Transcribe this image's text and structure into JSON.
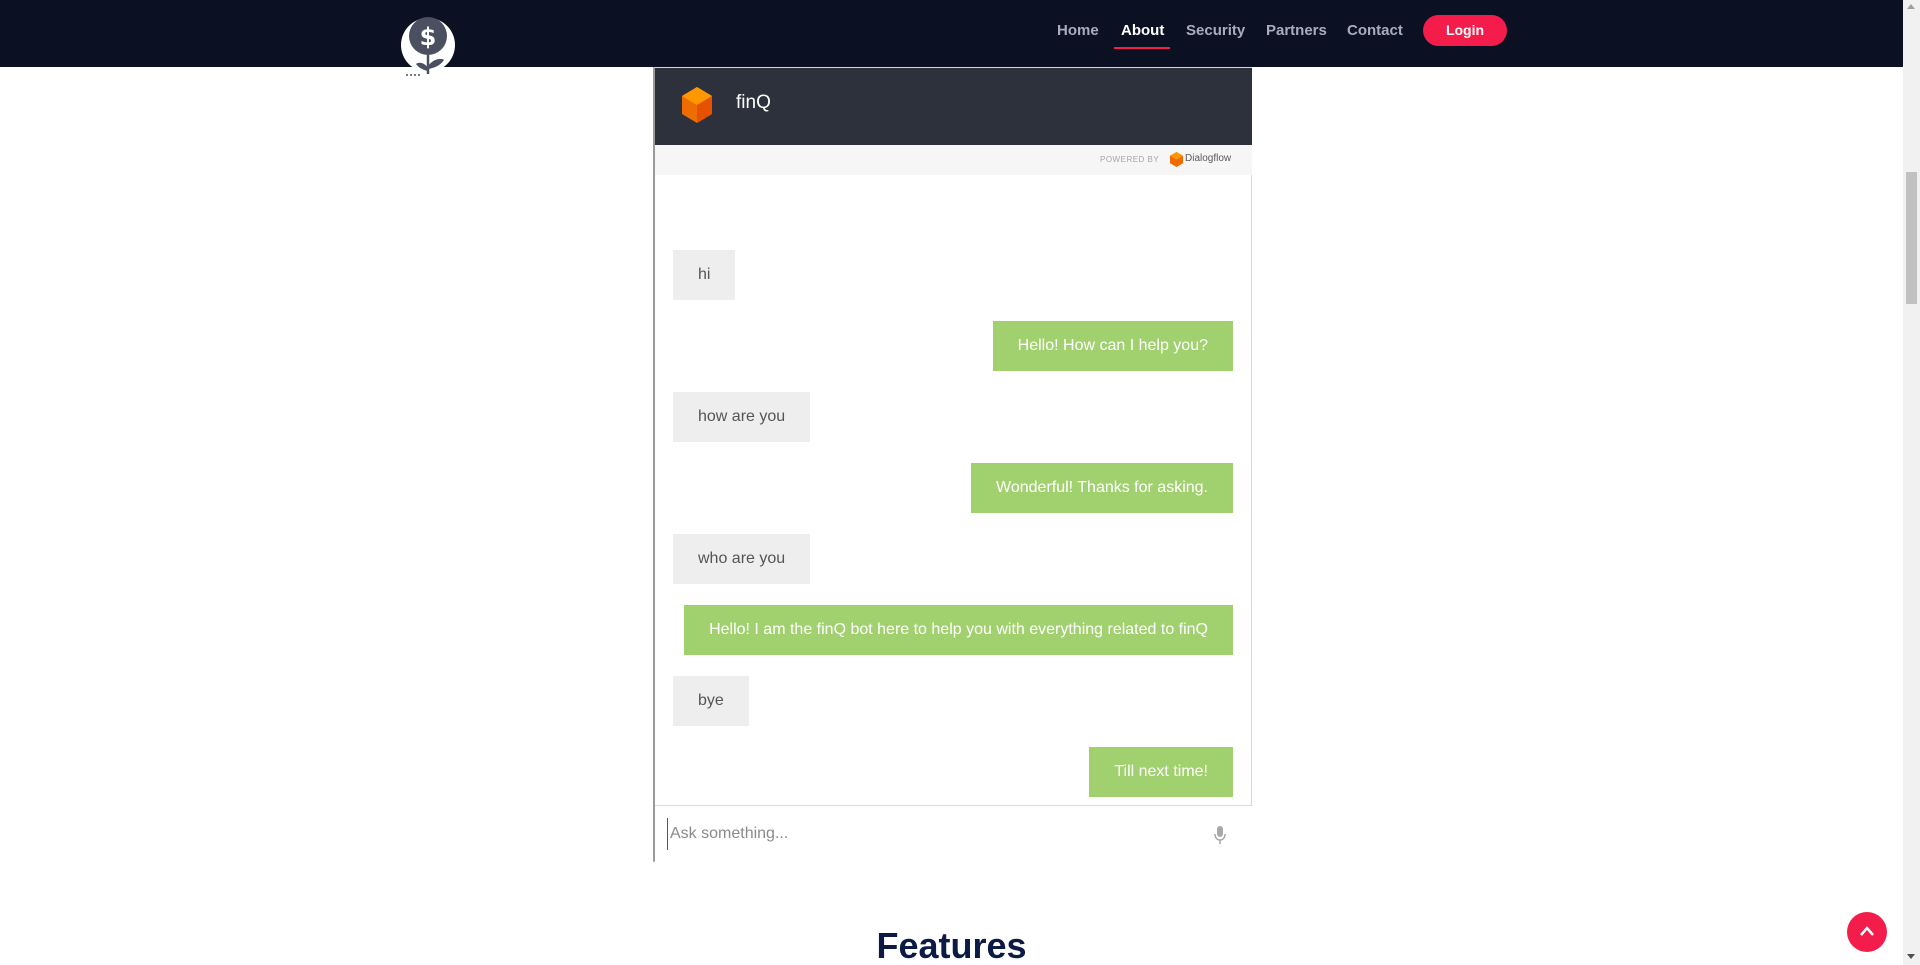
{
  "nav": {
    "links": [
      "Home",
      "About",
      "Security",
      "Partners",
      "Contact"
    ],
    "active": "About",
    "login_label": "Login"
  },
  "chat": {
    "bot_name": "finQ",
    "powered_by": "POWERED BY",
    "powered_brand": "Dialogflow",
    "messages": [
      {
        "from": "user",
        "text": "hi"
      },
      {
        "from": "bot",
        "text": "Hello! How can I help you?"
      },
      {
        "from": "user",
        "text": "how are you"
      },
      {
        "from": "bot",
        "text": "Wonderful! Thanks for asking."
      },
      {
        "from": "user",
        "text": "who are you"
      },
      {
        "from": "bot",
        "text": "Hello! I am the finQ bot here to help you with everything related to finQ"
      },
      {
        "from": "user",
        "text": "bye"
      },
      {
        "from": "bot",
        "text": "Till next time!"
      }
    ],
    "input_placeholder": "Ask something...",
    "input_value": ""
  },
  "section": {
    "features_title": "Features"
  },
  "colors": {
    "navbar_bg": "#0b1023",
    "accent": "#f41c4a",
    "bot_bubble": "#a1d16f",
    "user_bubble": "#eeeeee",
    "chat_header": "#2d313c",
    "heading": "#0b1b45"
  },
  "icons": {
    "logo": "dollar-plant-icon",
    "bot_avatar": "dialogflow-cube-icon",
    "mic": "microphone-icon",
    "to_top": "chevron-up-icon"
  }
}
